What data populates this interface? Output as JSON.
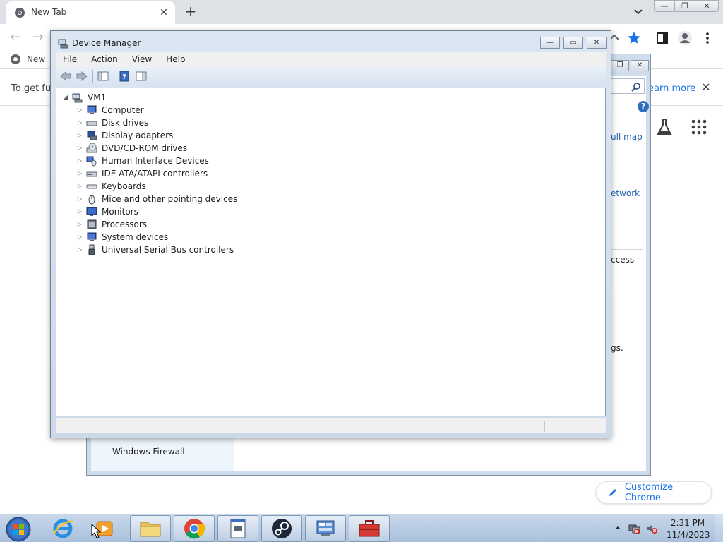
{
  "browser": {
    "tab_title": "New Tab",
    "bookmark_label": "New T",
    "infobar_text": "To get fut",
    "infobar_link": "earn more",
    "customize_label": "Customize Chrome"
  },
  "background_window": {
    "link_full_map": "ull map",
    "link_network": "etwork",
    "text_access": "ccess",
    "text_gs": "gs.",
    "left_item": "Windows Firewall"
  },
  "device_manager": {
    "title": "Device Manager",
    "menu": [
      "File",
      "Action",
      "View",
      "Help"
    ],
    "root": "VM1",
    "nodes": [
      {
        "label": "Computer",
        "icon": "computer-icon"
      },
      {
        "label": "Disk drives",
        "icon": "disk-drive-icon"
      },
      {
        "label": "Display adapters",
        "icon": "display-adapter-icon"
      },
      {
        "label": "DVD/CD-ROM drives",
        "icon": "dvd-drive-icon"
      },
      {
        "label": "Human Interface Devices",
        "icon": "hid-icon"
      },
      {
        "label": "IDE ATA/ATAPI controllers",
        "icon": "ide-controller-icon"
      },
      {
        "label": "Keyboards",
        "icon": "keyboard-icon"
      },
      {
        "label": "Mice and other pointing devices",
        "icon": "mouse-icon"
      },
      {
        "label": "Monitors",
        "icon": "monitor-icon"
      },
      {
        "label": "Processors",
        "icon": "processor-icon"
      },
      {
        "label": "System devices",
        "icon": "system-device-icon"
      },
      {
        "label": "Universal Serial Bus controllers",
        "icon": "usb-icon"
      }
    ]
  },
  "taskbar": {
    "time": "2:31 PM",
    "date": "11/4/2023"
  },
  "colors": {
    "chrome_accent": "#1a73e8",
    "taskbar": "#b7cbe3",
    "window_frame": "#cfdcec"
  }
}
